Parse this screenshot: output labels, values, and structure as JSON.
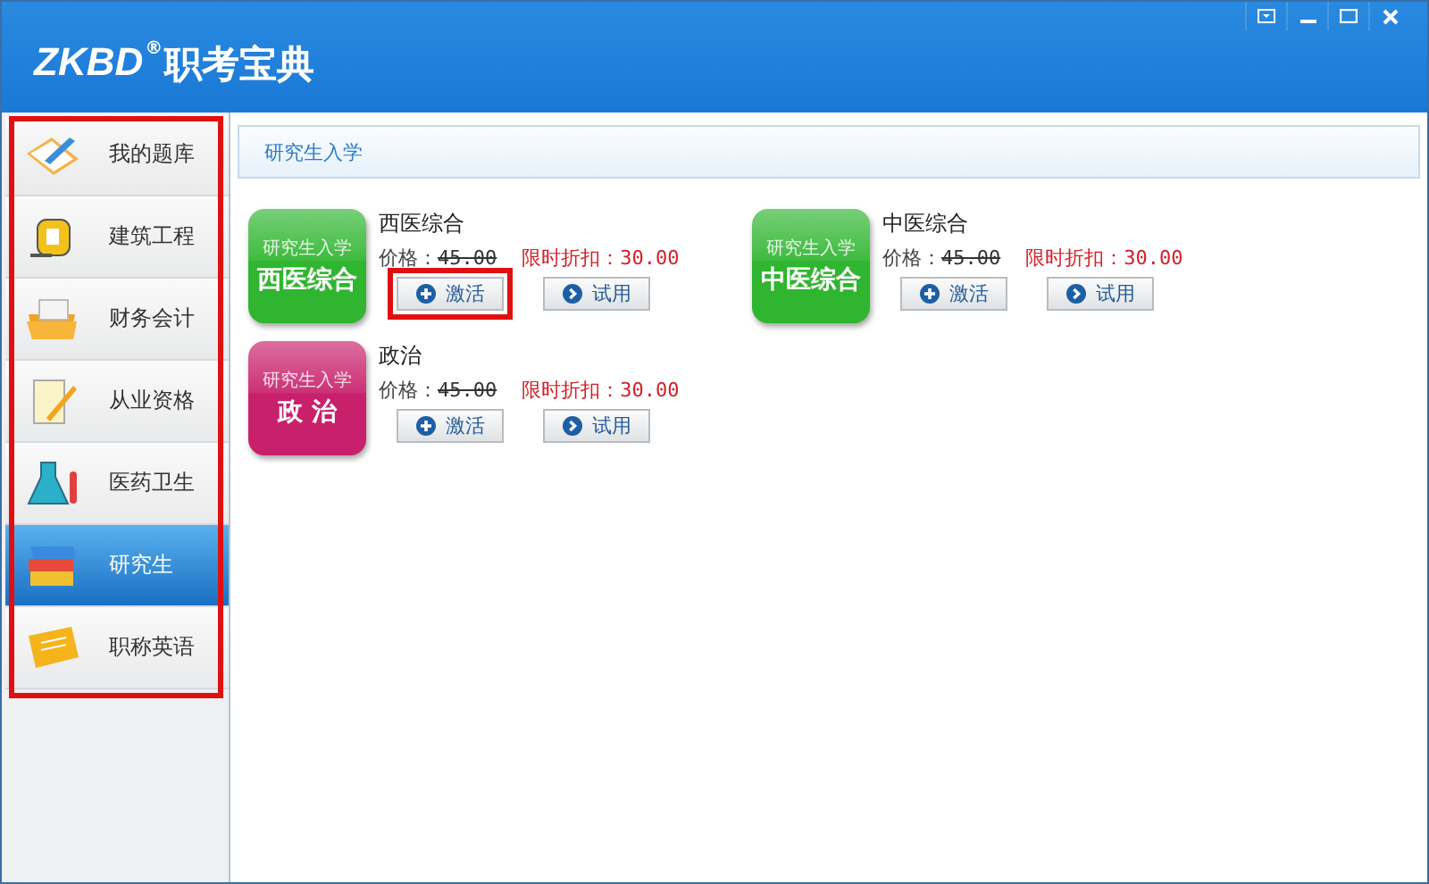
{
  "app": {
    "brand": "ZKBD",
    "registered": "®",
    "title": "职考宝典"
  },
  "sidebar": {
    "highlighted": true,
    "items": [
      {
        "label": "我的题库",
        "kind": "checklist",
        "selected": false
      },
      {
        "label": "建筑工程",
        "kind": "tape",
        "selected": false
      },
      {
        "label": "财务会计",
        "kind": "folder",
        "selected": false
      },
      {
        "label": "从业资格",
        "kind": "notepad",
        "selected": false
      },
      {
        "label": "医药卫生",
        "kind": "flask",
        "selected": false
      },
      {
        "label": "研究生",
        "kind": "books",
        "selected": true
      },
      {
        "label": "职称英语",
        "kind": "card",
        "selected": false
      }
    ]
  },
  "breadcrumb": "研究生入学",
  "products": [
    {
      "badge_top": "研究生入学",
      "badge_name": "西医综合",
      "color": "#2fb52f",
      "name": "西医综合",
      "price_label": "价格：",
      "price": "45.00",
      "discount_label": "限时折扣：",
      "discount": "30.00",
      "activate": {
        "label": "激活",
        "highlighted": true
      },
      "trial": "试用"
    },
    {
      "badge_top": "研究生入学",
      "badge_name": "中医综合",
      "color": "#2fb52f",
      "name": "中医综合",
      "price_label": "价格：",
      "price": "45.00",
      "discount_label": "限时折扣：",
      "discount": "30.00",
      "activate": {
        "label": "激活",
        "highlighted": false
      },
      "trial": "试用"
    },
    {
      "badge_top": "研究生入学",
      "badge_name": "政 治",
      "color": "#c8206a",
      "name": "政治",
      "price_label": "价格：",
      "price": "45.00",
      "discount_label": "限时折扣：",
      "discount": "30.00",
      "activate": {
        "label": "激活",
        "highlighted": false
      },
      "trial": "试用"
    }
  ]
}
